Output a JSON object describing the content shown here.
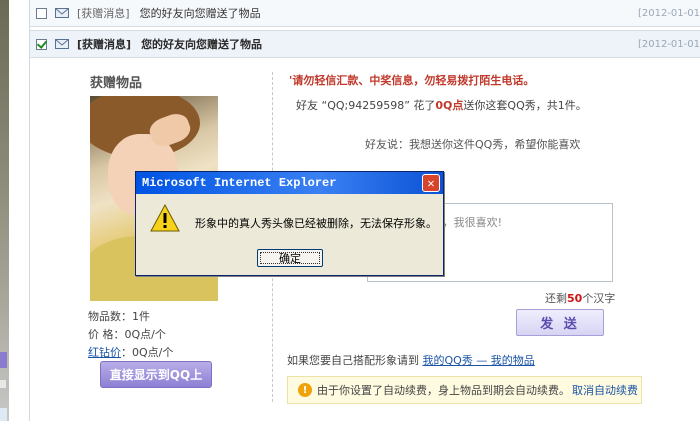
{
  "messages": [
    {
      "tag": "[获赠消息]",
      "title": "您的好友向您赠送了物品",
      "date": "[2012-01-01",
      "checked": false
    },
    {
      "tag": "[获赠消息]",
      "title": "您的好友向您赠送了物品",
      "date": "[2012-01-01",
      "checked": true
    }
  ],
  "detail": {
    "heading": "获赠物品",
    "item_count": "物品数：1件",
    "price": "价 格：0Q点/个",
    "red_diamond_link": "红钻价",
    "red_diamond_value": "：0Q点/个",
    "show_button": "直接显示到QQ上",
    "warning": "'请勿轻信汇款、中奖信息，勿轻易拨打陌生电话。",
    "gift_prefix": "好友 “QQ;94259598” 花了",
    "gift_amount": "0Q点",
    "gift_suffix": "送你这套QQ秀，共1件。",
    "friend_say": "好友说：我想送你这件QQ秀，希望你能喜欢",
    "reply_text": "，我很喜欢!",
    "remain_prefix": "还剩",
    "remain_count": "50",
    "remain_suffix": "个汉字",
    "send_button": "发 送",
    "match_prefix": "如果您要自己搭配形象请到",
    "match_link": "我的QQ秀 — 我的物品",
    "renew_text": "由于你设置了自动续费，身上物品到期会自动续费。",
    "renew_link": "取消自动续费"
  },
  "dialog": {
    "title": "Microsoft Internet Explorer",
    "message": "形象中的真人秀头像已经被删除，无法保存形象。",
    "ok_button": "确定",
    "close_symbol": "✕"
  },
  "icons": {
    "envelope": "envelope-icon",
    "warning": "warning-icon",
    "info": "warning-circle-icon",
    "close": "close-icon"
  },
  "colors": {
    "title_bar": "#0054e3",
    "warning_red": "#c0392b",
    "link_blue": "#1a54a6",
    "button_purple": "#8d7fd4"
  }
}
